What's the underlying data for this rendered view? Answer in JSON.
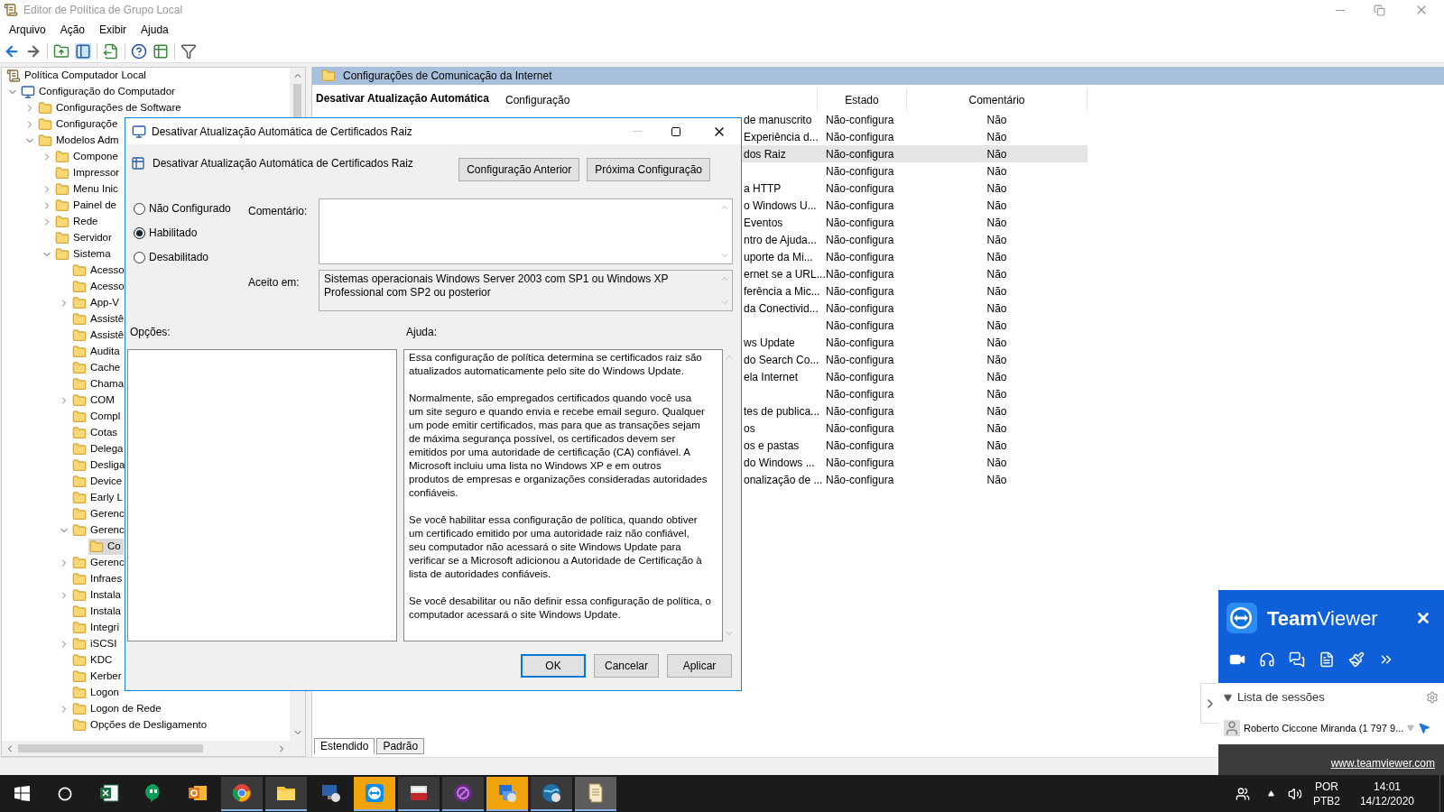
{
  "window": {
    "title": "Editor de Política de Grupo Local"
  },
  "menu": [
    "Arquivo",
    "Ação",
    "Exibir",
    "Ajuda"
  ],
  "tree": [
    {
      "label": "Política Computador Local",
      "selected": false,
      "children": [
        {
          "label": "Configuração do Computador",
          "expanded": true,
          "selected": false,
          "children": [
            {
              "label": "Configurações de Software",
              "expanded": false,
              "selected": false
            },
            {
              "label": "Configuraçõe",
              "expanded": false,
              "selected": false
            },
            {
              "label": "Modelos Adm",
              "expanded": true,
              "selected": false,
              "children": [
                {
                  "label": "Compone",
                  "expanded": false,
                  "selected": false
                },
                {
                  "label": "Impressor",
                  "selected": false
                },
                {
                  "label": "Menu Inic",
                  "expanded": false,
                  "selected": false
                },
                {
                  "label": "Painel de",
                  "expanded": false,
                  "selected": false
                },
                {
                  "label": "Rede",
                  "expanded": false,
                  "selected": false
                },
                {
                  "label": "Servidor",
                  "selected": false
                },
                {
                  "label": "Sistema",
                  "expanded": true,
                  "selected": false,
                  "children": [
                    {
                      "label": "Acesso",
                      "selected": false
                    },
                    {
                      "label": "Acesso",
                      "selected": false
                    },
                    {
                      "label": "App-V",
                      "expanded": false,
                      "selected": false
                    },
                    {
                      "label": "Assistê",
                      "selected": false
                    },
                    {
                      "label": "Assistê",
                      "selected": false
                    },
                    {
                      "label": "Audita",
                      "selected": false
                    },
                    {
                      "label": "Cache",
                      "selected": false
                    },
                    {
                      "label": "Chama",
                      "selected": false
                    },
                    {
                      "label": "COM",
                      "expanded": false,
                      "selected": false
                    },
                    {
                      "label": "Compl",
                      "selected": false
                    },
                    {
                      "label": "Cotas",
                      "selected": false
                    },
                    {
                      "label": "Delega",
                      "selected": false
                    },
                    {
                      "label": "Desliga",
                      "selected": false
                    },
                    {
                      "label": "Device",
                      "selected": false
                    },
                    {
                      "label": "Early L",
                      "selected": false
                    },
                    {
                      "label": "Gerenc",
                      "selected": false
                    },
                    {
                      "label": "Gerenc",
                      "expanded": true,
                      "selected": false,
                      "children": [
                        {
                          "label": "Co",
                          "selected": true
                        }
                      ]
                    },
                    {
                      "label": "Gerenc",
                      "expanded": false,
                      "selected": false
                    },
                    {
                      "label": "Infraes",
                      "selected": false
                    },
                    {
                      "label": "Instala",
                      "expanded": false,
                      "selected": false
                    },
                    {
                      "label": "Instala",
                      "selected": false
                    },
                    {
                      "label": "Integri",
                      "selected": false
                    },
                    {
                      "label": "iSCSI",
                      "expanded": false,
                      "selected": false
                    },
                    {
                      "label": "KDC",
                      "selected": false
                    },
                    {
                      "label": "Kerber",
                      "selected": false
                    },
                    {
                      "label": "Logon",
                      "selected": false
                    },
                    {
                      "label": "Logon de Rede",
                      "expanded": false,
                      "selected": false
                    },
                    {
                      "label": "Opções de Desligamento",
                      "selected": false
                    }
                  ]
                }
              ]
            }
          ]
        }
      ]
    }
  ],
  "details": {
    "header": "Configurações de Comunicação da Internet",
    "description_title": "Desativar Atualização Automática",
    "columns": [
      "Configuração",
      "Estado",
      "Comentário"
    ],
    "rows": [
      {
        "setting": "de manuscrito",
        "state": "Não-configura",
        "comment": "Não",
        "selected": false
      },
      {
        "setting": "Experiência d...",
        "state": "Não-configura",
        "comment": "Não",
        "selected": false
      },
      {
        "setting": "dos Raiz",
        "state": "Não-configura",
        "comment": "Não",
        "selected": true
      },
      {
        "state": "Não-configura",
        "comment": "Não",
        "selected": false
      },
      {
        "setting": "a HTTP",
        "state": "Não-configura",
        "comment": "Não",
        "selected": false
      },
      {
        "setting": "o Windows U...",
        "state": "Não-configura",
        "comment": "Não",
        "selected": false
      },
      {
        "setting": "Eventos",
        "state": "Não-configura",
        "comment": "Não",
        "selected": false
      },
      {
        "setting": "ntro de Ajuda...",
        "state": "Não-configura",
        "comment": "Não",
        "selected": false
      },
      {
        "setting": "uporte da Mi...",
        "state": "Não-configura",
        "comment": "Não",
        "selected": false
      },
      {
        "setting": "ernet se a URL...",
        "state": "Não-configura",
        "comment": "Não",
        "selected": false
      },
      {
        "setting": "ferência a Mic...",
        "state": "Não-configura",
        "comment": "Não",
        "selected": false
      },
      {
        "setting": "da Conectivid...",
        "state": "Não-configura",
        "comment": "Não",
        "selected": false
      },
      {
        "state": "Não-configura",
        "comment": "Não",
        "selected": false
      },
      {
        "setting": "ws Update",
        "state": "Não-configura",
        "comment": "Não",
        "selected": false
      },
      {
        "setting": "do Search Co...",
        "state": "Não-configura",
        "comment": "Não",
        "selected": false
      },
      {
        "setting": "ela Internet",
        "state": "Não-configura",
        "comment": "Não",
        "selected": false
      },
      {
        "state": "Não-configura",
        "comment": "Não",
        "selected": false
      },
      {
        "setting": "tes de publica...",
        "state": "Não-configura",
        "comment": "Não",
        "selected": false
      },
      {
        "setting": "os",
        "state": "Não-configura",
        "comment": "Não",
        "selected": false
      },
      {
        "setting": "os e pastas",
        "state": "Não-configura",
        "comment": "Não",
        "selected": false
      },
      {
        "setting": "do Windows ...",
        "state": "Não-configura",
        "comment": "Não",
        "selected": false
      },
      {
        "setting": "onalização de ...",
        "state": "Não-configura",
        "comment": "Não",
        "selected": false
      }
    ],
    "tabs": [
      {
        "label": "Estendido",
        "selected": true
      },
      {
        "label": "Padrão",
        "selected": false
      }
    ]
  },
  "dialog": {
    "title": "Desativar Atualização Automática de Certificados Raiz",
    "setting_name": "Desativar Atualização Automática de Certificados Raiz",
    "nav_buttons": [
      "Configuração Anterior",
      "Próxima Configuração"
    ],
    "options": [
      {
        "label": "Não Configurado",
        "selected": false
      },
      {
        "label": "Habilitado",
        "selected": true
      },
      {
        "label": "Desabilitado",
        "selected": false
      }
    ],
    "comment_label": "Comentário:",
    "supported_label": "Aceito em:",
    "supported_lines": [
      "Sistemas operacionais Windows Server 2003 com SP1 ou Windows XP",
      "Professional com SP2 ou posterior"
    ],
    "options_label": "Opções:",
    "help_label": "Ajuda:",
    "help_paragraphs": [
      [
        "Essa configuração de política determina se certificados raiz são",
        "atualizados automaticamente pelo site do Windows Update."
      ],
      [
        "Normalmente, são empregados certificados quando você usa",
        "um site seguro e quando envia e recebe email seguro. Qualquer",
        "um pode emitir certificados, mas para que as transações sejam",
        "de máxima segurança possível, os certificados devem ser",
        "emitidos por uma autoridade de certificação (CA) confiável. A",
        "Microsoft incluiu uma lista no Windows XP e em outros",
        "produtos de empresas e organizações consideradas autoridades",
        "confiáveis."
      ],
      [
        "Se você habilitar essa configuração de política, quando obtiver",
        "um certificado emitido por uma autoridade raiz não confiável,",
        "seu computador não acessará o site Windows Update para",
        "verificar se a Microsoft adicionou a Autoridade de Certificação à",
        "lista de autoridades confiáveis."
      ],
      [
        "Se você desabilitar ou não definir essa configuração de política, o",
        "computador acessará o site Windows Update."
      ]
    ],
    "buttons": [
      {
        "label": "OK",
        "default": true
      },
      {
        "label": "Cancelar",
        "default": false
      },
      {
        "label": "Aplicar",
        "default": false
      }
    ]
  },
  "teamviewer": {
    "brand": "**Team**Viewer",
    "section": "Lista de sessões",
    "session": "Roberto Ciccone Miranda (1 797 9...",
    "link": "www.teamviewer.com"
  },
  "taskbar": {
    "apps": [
      {
        "running": false,
        "flashing": false,
        "active": false
      },
      {
        "running": false,
        "flashing": false,
        "active": false
      },
      {
        "running": false,
        "flashing": false,
        "active": false
      },
      {
        "running": true,
        "flashing": false,
        "active": false
      },
      {
        "running": true,
        "flashing": false,
        "active": false
      },
      {
        "running": false,
        "flashing": false,
        "active": false
      },
      {
        "running": true,
        "flashing": true,
        "active": false
      },
      {
        "running": true,
        "flashing": false,
        "active": false
      },
      {
        "running": true,
        "flashing": false,
        "active": false
      },
      {
        "running": true,
        "flashing": true,
        "active": false
      },
      {
        "running": true,
        "flashing": false,
        "active": false
      },
      {
        "running": true,
        "flashing": false,
        "active": true
      }
    ],
    "language": "POR",
    "layout": "PTB2",
    "time": "14:01",
    "date": "14/12/2020"
  }
}
